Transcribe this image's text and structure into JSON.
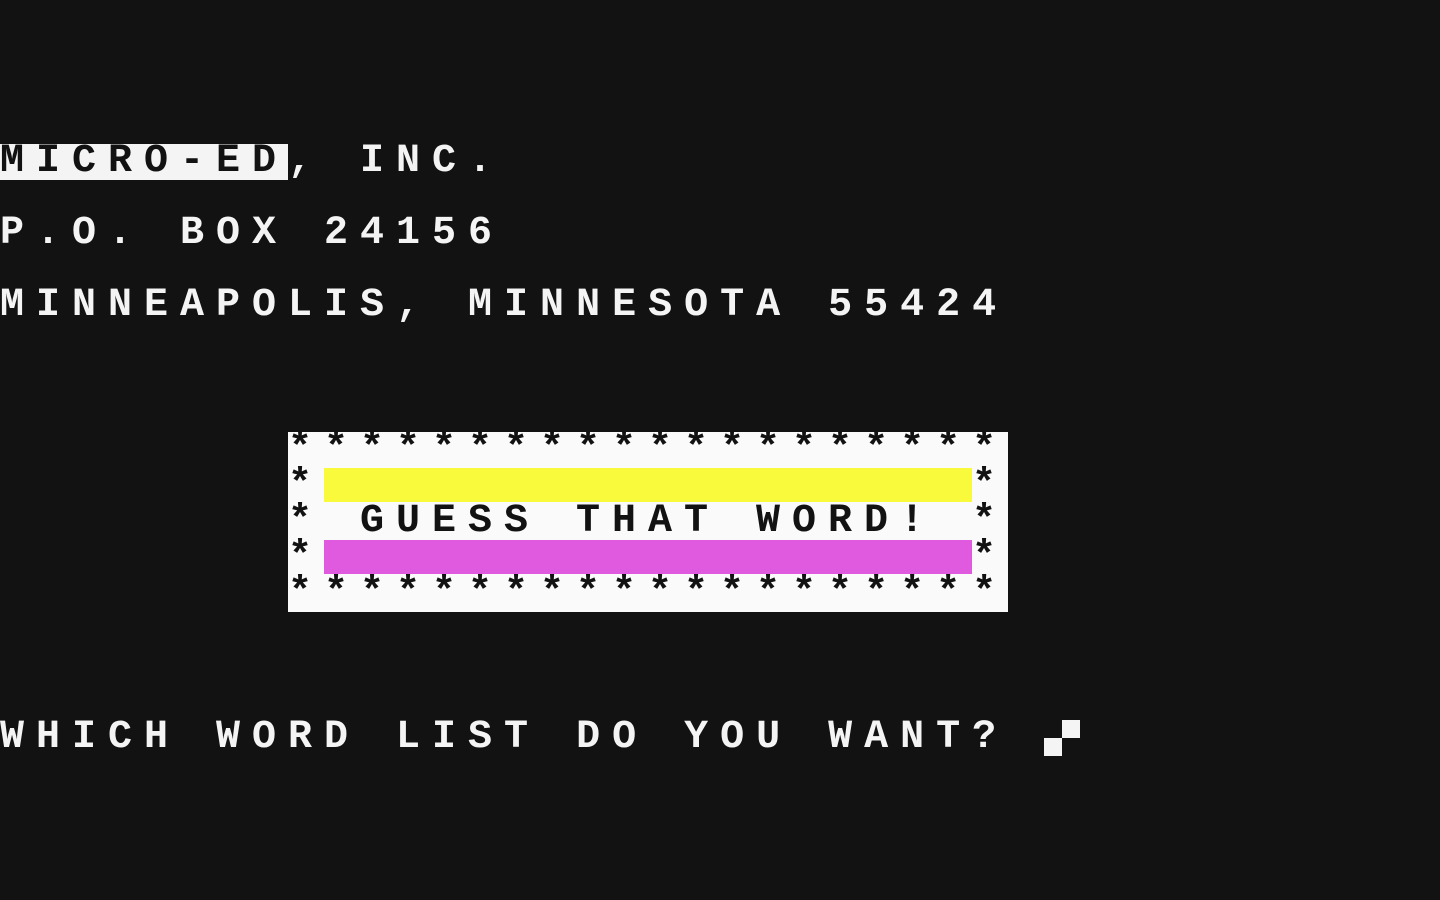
{
  "company": {
    "name_highlighted": "MICRO-ED",
    "name_rest": ", INC.",
    "address_line": "P.O. BOX 24156",
    "city_line": "MINNEAPOLIS, MINNESOTA 55424"
  },
  "title_box": {
    "border_top": "********************",
    "border_bottom": "********************",
    "side": "*",
    "title": "GUESS THAT WORD!",
    "colors": {
      "top_bar": "#fafa3c",
      "bottom_bar": "#e05ae0",
      "box": "#fafafa"
    }
  },
  "prompt": {
    "text": "WHICH WORD LIST DO YOU WANT?",
    "cursor": "checker-cursor-icon"
  }
}
